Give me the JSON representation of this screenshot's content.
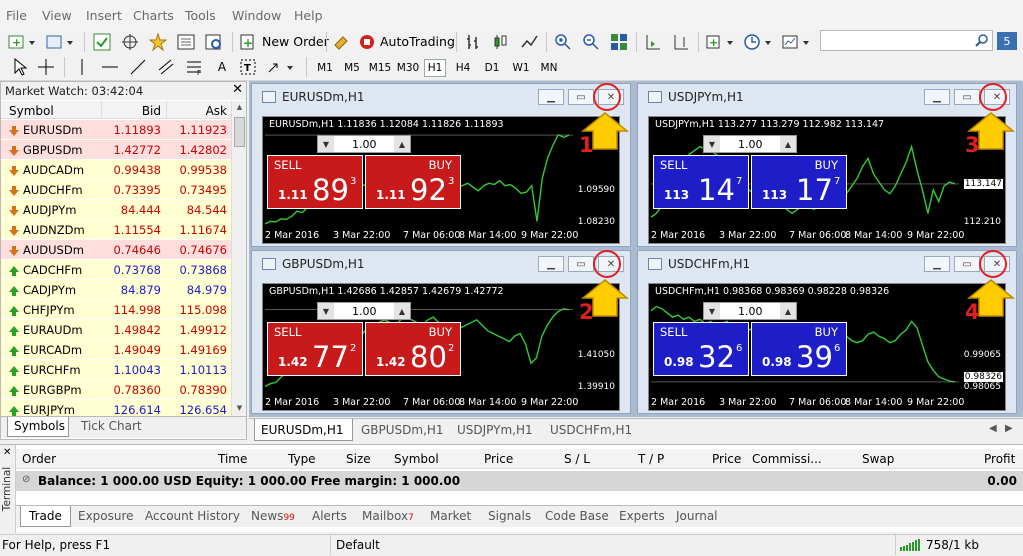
{
  "menu": [
    "File",
    "View",
    "Insert",
    "Charts",
    "Tools",
    "Window",
    "Help"
  ],
  "toolbar": {
    "new_order": "New Order",
    "autotrading": "AutoTrading",
    "timeframes": [
      "M1",
      "M5",
      "M15",
      "M30",
      "H1",
      "H4",
      "D1",
      "W1",
      "MN"
    ],
    "search_placeholder": "",
    "text_tool": "A"
  },
  "market_watch": {
    "title": "Market Watch: 03:42:04",
    "close": "✕",
    "headers": {
      "symbol": "Symbol",
      "bid": "Bid",
      "ask": "Ask"
    },
    "rows": [
      {
        "symbol": "EURUSDm",
        "bid": "1.11893",
        "ask": "1.11923",
        "dir": "down",
        "bg": "#ffdede",
        "color": "#cc0000"
      },
      {
        "symbol": "GBPUSDm",
        "bid": "1.42772",
        "ask": "1.42802",
        "dir": "down",
        "bg": "#ffdede",
        "color": "#cc0000"
      },
      {
        "symbol": "AUDCADm",
        "bid": "0.99438",
        "ask": "0.99538",
        "dir": "down",
        "bg": "#ffffd2",
        "color": "#cc0000"
      },
      {
        "symbol": "AUDCHFm",
        "bid": "0.73395",
        "ask": "0.73495",
        "dir": "down",
        "bg": "#ffffd2",
        "color": "#cc0000"
      },
      {
        "symbol": "AUDJPYm",
        "bid": "84.444",
        "ask": "84.544",
        "dir": "down",
        "bg": "#ffffd2",
        "color": "#cc0000"
      },
      {
        "symbol": "AUDNZDm",
        "bid": "1.11554",
        "ask": "1.11674",
        "dir": "down",
        "bg": "#ffffd2",
        "color": "#cc0000"
      },
      {
        "symbol": "AUDUSDm",
        "bid": "0.74646",
        "ask": "0.74676",
        "dir": "down",
        "bg": "#ffdede",
        "color": "#cc0000"
      },
      {
        "symbol": "CADCHFm",
        "bid": "0.73768",
        "ask": "0.73868",
        "dir": "up",
        "bg": "#ffffd2",
        "color": "#1a1ad0"
      },
      {
        "symbol": "CADJPYm",
        "bid": "84.879",
        "ask": "84.979",
        "dir": "up",
        "bg": "#ffffd2",
        "color": "#1a1ad0"
      },
      {
        "symbol": "CHFJPYm",
        "bid": "114.998",
        "ask": "115.098",
        "dir": "up",
        "bg": "#ffffd2",
        "color": "#cc0000"
      },
      {
        "symbol": "EURAUDm",
        "bid": "1.49842",
        "ask": "1.49912",
        "dir": "up",
        "bg": "#ffffd2",
        "color": "#cc0000"
      },
      {
        "symbol": "EURCADm",
        "bid": "1.49049",
        "ask": "1.49169",
        "dir": "up",
        "bg": "#ffffd2",
        "color": "#cc0000"
      },
      {
        "symbol": "EURCHFm",
        "bid": "1.10043",
        "ask": "1.10113",
        "dir": "up",
        "bg": "#ffffd2",
        "color": "#1a1ad0"
      },
      {
        "symbol": "EURGBPm",
        "bid": "0.78360",
        "ask": "0.78390",
        "dir": "up",
        "bg": "#ffffd2",
        "color": "#cc0000"
      },
      {
        "symbol": "EURJPYm",
        "bid": "126.614",
        "ask": "126.654",
        "dir": "up",
        "bg": "#ffffd2",
        "color": "#1a1ad0"
      }
    ],
    "tabs": [
      "Symbols",
      "Tick Chart"
    ]
  },
  "charts": [
    {
      "title": "EURUSDm,H1",
      "info": "EURUSDm,H1  1.11836 1.12084 1.11826 1.11893",
      "lot": "1.00",
      "sell_label": "SELL",
      "buy_label": "BUY",
      "sell_small": "1.11",
      "sell_big": "89",
      "sell_sup": "3",
      "buy_small": "1.11",
      "buy_big": "92",
      "buy_sup": "3",
      "theme": "red",
      "yticks": [
        "1.1",
        "1.09590",
        "1.08230"
      ],
      "ytick_pos": [
        14,
        68,
        100
      ],
      "xticks": [
        "2 Mar 2016",
        "3 Mar 22:00",
        "7 Mar 06:00",
        "8 Mar 14:00",
        "9 Mar 22:00"
      ],
      "annotation": "1",
      "price_data": [
        1.084,
        1.085,
        1.0848,
        1.086,
        1.0858,
        1.087,
        1.089,
        1.0885,
        1.0905,
        1.092,
        1.093,
        1.096,
        1.095,
        1.097,
        1.0975,
        1.096,
        1.0965,
        1.098,
        1.0995,
        1.099,
        1.1,
        1.0998,
        1.101,
        1.099,
        1.0975,
        1.0985,
        1.097,
        1.099,
        1.098,
        1.0995,
        1.1,
        1.099,
        1.0975,
        1.0985,
        1.099,
        1.097,
        1.0985,
        1.099,
        1.1,
        1.0985,
        1.097,
        1.099,
        1.1,
        1.0995,
        1.101,
        1.099,
        1.0995,
        1.098,
        1.096,
        1.0965,
        1.099,
        1.085,
        1.102,
        1.11,
        1.115,
        1.119,
        1.118,
        1.1189
      ],
      "ylim": [
        1.082,
        1.1205
      ]
    },
    {
      "title": "USDJPYm,H1",
      "info": "USDJPYm,H1  113.277 113.279 112.982 113.147",
      "lot": "1.00",
      "sell_label": "SELL",
      "buy_label": "BUY",
      "sell_small": "113",
      "sell_big": "14",
      "sell_sup": "7",
      "buy_small": "113",
      "buy_big": "17",
      "buy_sup": "7",
      "theme": "blue",
      "yticks": [
        "113.147",
        "112.210"
      ],
      "ytick_pos": [
        62,
        100
      ],
      "xticks": [
        "2 Mar 2016",
        "3 Mar 22:00",
        "7 Mar 06:00",
        "8 Mar 14:00",
        "9 Mar 22:00"
      ],
      "annotation": "3",
      "price_data": [
        112.3,
        112.4,
        112.6,
        112.9,
        113.2,
        113.4,
        113.6,
        113.9,
        114.0,
        114.1,
        114.05,
        114.0,
        113.9,
        113.8,
        113.7,
        113.5,
        113.3,
        113.2,
        113.0,
        112.9,
        112.7,
        112.8,
        112.7,
        112.6,
        112.7,
        112.5,
        112.4,
        112.5,
        112.6,
        112.7,
        112.5,
        112.6,
        112.7,
        112.8,
        112.7,
        112.8,
        112.9,
        113.1,
        113.3,
        113.6,
        113.8,
        113.4,
        113.2,
        113.0,
        112.9,
        113.1,
        113.4,
        113.7,
        114.1,
        113.5,
        113.0,
        112.4,
        113.0,
        112.7,
        113.1,
        113.2,
        113.15
      ],
      "ylim": [
        112.0,
        114.5
      ]
    },
    {
      "title": "GBPUSDm,H1",
      "info": "GBPUSDm,H1  1.42686 1.42857 1.42679 1.42772",
      "lot": "1.00",
      "sell_label": "SELL",
      "buy_label": "BUY",
      "sell_small": "1.42",
      "sell_big": "77",
      "sell_sup": "2",
      "buy_small": "1.42",
      "buy_big": "80",
      "buy_sup": "2",
      "theme": "red",
      "yticks": [
        "1.4",
        "1.41050",
        "1.39910"
      ],
      "ytick_pos": [
        14,
        66,
        98
      ],
      "xticks": [
        "2 Mar 2016",
        "3 Mar 22:00",
        "7 Mar 06:00",
        "8 Mar 14:00",
        "9 Mar 22:00"
      ],
      "annotation": "2",
      "price_data": [
        1.3995,
        1.4005,
        1.401,
        1.403,
        1.405,
        1.406,
        1.408,
        1.409,
        1.41,
        1.412,
        1.413,
        1.414,
        1.415,
        1.416,
        1.415,
        1.4155,
        1.417,
        1.418,
        1.419,
        1.421,
        1.422,
        1.423,
        1.424,
        1.423,
        1.422,
        1.424,
        1.425,
        1.424,
        1.423,
        1.422,
        1.424,
        1.425,
        1.423,
        1.422,
        1.421,
        1.42,
        1.421,
        1.422,
        1.423,
        1.424,
        1.422,
        1.42,
        1.419,
        1.418,
        1.417,
        1.416,
        1.418,
        1.419,
        1.415,
        1.408,
        1.41,
        1.418,
        1.422,
        1.425,
        1.427,
        1.428,
        1.4277
      ],
      "ylim": [
        1.396,
        1.432
      ]
    },
    {
      "title": "USDCHFm,H1",
      "info": "USDCHFm,H1  0.98368 0.98369 0.98228 0.98326",
      "lot": "1.00",
      "sell_label": "SELL",
      "buy_label": "BUY",
      "sell_small": "0.98",
      "sell_big": "32",
      "sell_sup": "6",
      "buy_small": "0.98",
      "buy_big": "39",
      "buy_sup": "6",
      "theme": "blue",
      "yticks": [
        "0.99065",
        "0.98326",
        "0.98065"
      ],
      "ytick_pos": [
        66,
        88,
        98
      ],
      "xticks": [
        "2 Mar 2016",
        "3 Mar 22:00",
        "7 Mar 06:00",
        "8 Mar 14:00",
        "9 Mar 22:00"
      ],
      "annotation": "4",
      "price_data": [
        1.0,
        1.001,
        1.0005,
        0.9995,
        0.9985,
        0.999,
        0.998,
        0.9985,
        0.9975,
        0.998,
        0.997,
        0.9975,
        0.9965,
        0.997,
        0.9975,
        0.996,
        0.9965,
        0.997,
        0.9955,
        0.996,
        0.995,
        0.9955,
        0.9945,
        0.995,
        0.994,
        0.9955,
        0.996,
        0.9945,
        0.995,
        0.994,
        0.9935,
        0.9945,
        0.994,
        0.993,
        0.9935,
        0.9945,
        0.994,
        0.993,
        0.9925,
        0.993,
        0.9945,
        0.995,
        0.994,
        0.9935,
        0.9925,
        0.993,
        0.9945,
        0.9955,
        0.9975,
        0.996,
        0.992,
        0.988,
        0.986,
        0.9845,
        0.984,
        0.9835,
        0.9833
      ],
      "ylim": [
        0.98,
        1.003
      ]
    }
  ],
  "chart_tabs": [
    "EURUSDm,H1",
    "GBPUSDm,H1",
    "USDJPYm,H1",
    "USDCHFm,H1"
  ],
  "terminal": {
    "side_label": "Terminal",
    "headers": [
      "Order",
      "Time",
      "Type",
      "Size",
      "Symbol",
      "Price",
      "S / L",
      "T / P",
      "Price",
      "Commissi...",
      "Swap",
      "Profit"
    ],
    "balance_text": "Balance: 1 000.00 USD  Equity: 1 000.00  Free margin: 1 000.00",
    "balance_profit": "0.00",
    "tabs": [
      {
        "label": "Trade",
        "badge": ""
      },
      {
        "label": "Exposure",
        "badge": ""
      },
      {
        "label": "Account History",
        "badge": ""
      },
      {
        "label": "News",
        "badge": "99"
      },
      {
        "label": "Alerts",
        "badge": ""
      },
      {
        "label": "Mailbox",
        "badge": "7"
      },
      {
        "label": "Market",
        "badge": ""
      },
      {
        "label": "Signals",
        "badge": ""
      },
      {
        "label": "Code Base",
        "badge": ""
      },
      {
        "label": "Experts",
        "badge": ""
      },
      {
        "label": "Journal",
        "badge": ""
      }
    ]
  },
  "status": {
    "help": "For Help, press F1",
    "profile": "Default",
    "traffic": "758/1 kb"
  },
  "colors": {
    "sell_red": "#c81a1a",
    "buy_blue": "#1e1ec8",
    "candle_green": "#33cc33",
    "annotation_red": "#e02020",
    "arrow_yellow": "#ffcc00"
  }
}
